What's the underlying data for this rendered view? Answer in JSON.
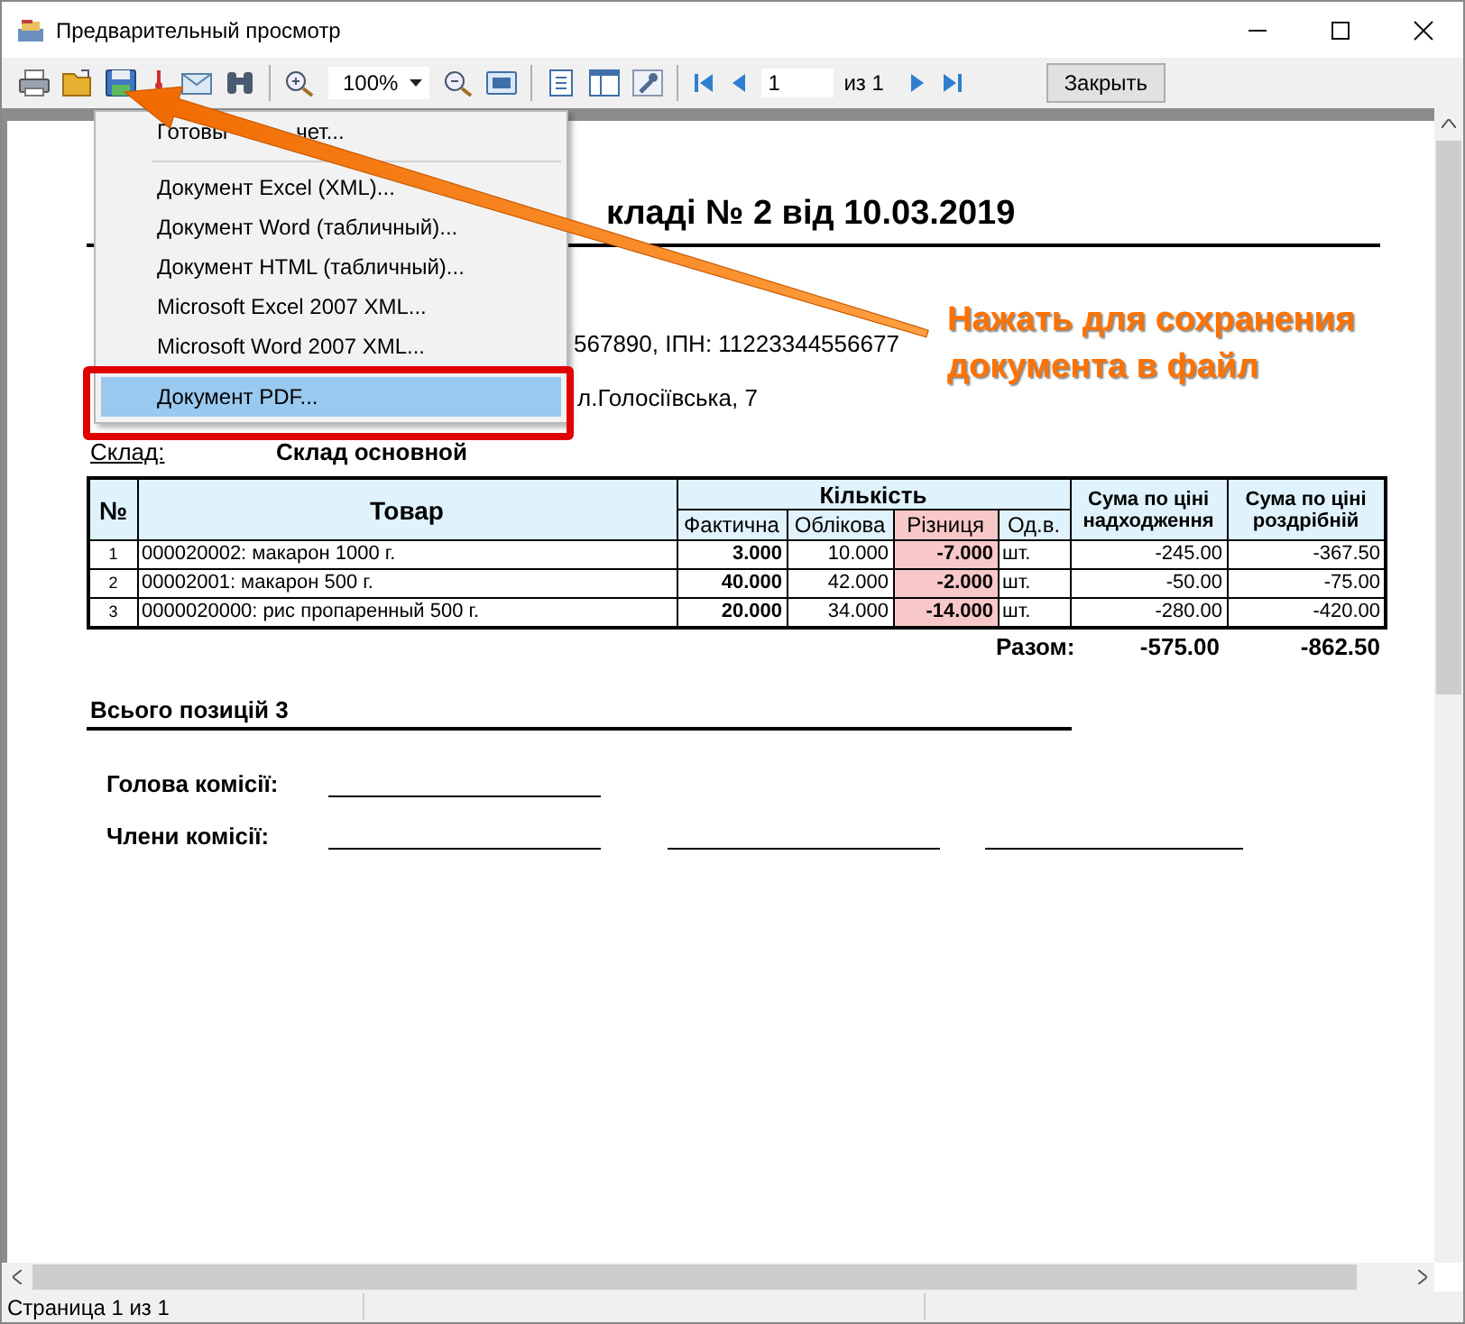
{
  "window": {
    "title": "Предварительный просмотр"
  },
  "toolbar": {
    "zoom": "100%",
    "page": "1",
    "page_of": "из 1",
    "close": "Закрыть"
  },
  "save_menu": {
    "groups": [
      [
        {
          "label": "Готовы",
          "label_end": "чет...",
          "selected": false,
          "highlighted": false
        }
      ],
      [
        {
          "label": "Документ Excel (XML)...",
          "selected": false,
          "highlighted": false
        },
        {
          "label": "Документ Word (табличный)...",
          "selected": false,
          "highlighted": false
        },
        {
          "label": "Документ HTML (табличный)...",
          "selected": false,
          "highlighted": false
        },
        {
          "label": "Microsoft Excel 2007 XML...",
          "selected": false,
          "highlighted": false
        },
        {
          "label": "Microsoft Word 2007 XML...",
          "selected": false,
          "highlighted": false
        },
        {
          "label": "Документ PDF...",
          "selected": true,
          "highlighted": true
        }
      ]
    ]
  },
  "callout": "Нажать для сохранения\nдокумента в файл",
  "document": {
    "title": "кладі № 2 від 10.03.2019",
    "lines": [
      "567890, ІПН: 11223344556677",
      "л.Голосіївська, 7"
    ],
    "warehouse_label": "Склад:",
    "warehouse": "Склад основной",
    "table": {
      "columns": {
        "no": "№",
        "product": "Товар",
        "quantity": "Кількість",
        "quantity_sub": [
          "Фактична",
          "Облікова",
          "Різниця",
          "Од.в."
        ],
        "sum_in": "Сума по ціні надходження",
        "sum_retail": "Сума по ціні роздрібній"
      },
      "rows": [
        {
          "no": "1",
          "product": "000020002: макарон 1000 г.",
          "actual": "3.000",
          "accounting": "10.000",
          "diff": "-7.000",
          "unit": "шт.",
          "sum_in": "-245.00",
          "sum_retail": "-367.50"
        },
        {
          "no": "2",
          "product": "00002001: макарон 500 г.",
          "actual": "40.000",
          "accounting": "42.000",
          "diff": "-2.000",
          "unit": "шт.",
          "sum_in": "-50.00",
          "sum_retail": "-75.00"
        },
        {
          "no": "3",
          "product": "0000020000: рис пропаренный 500 г.",
          "actual": "20.000",
          "accounting": "34.000",
          "diff": "-14.000",
          "unit": "шт.",
          "sum_in": "-280.00",
          "sum_retail": "-420.00"
        }
      ],
      "total_label": "Разом:",
      "total_in": "-575.00",
      "total_retail": "-862.50"
    },
    "positions": "Всього позицій 3",
    "head_label": "Голова комісії:",
    "members_label": "Члени комісії:"
  },
  "status_bar": {
    "page": "Страница 1 из 1"
  }
}
